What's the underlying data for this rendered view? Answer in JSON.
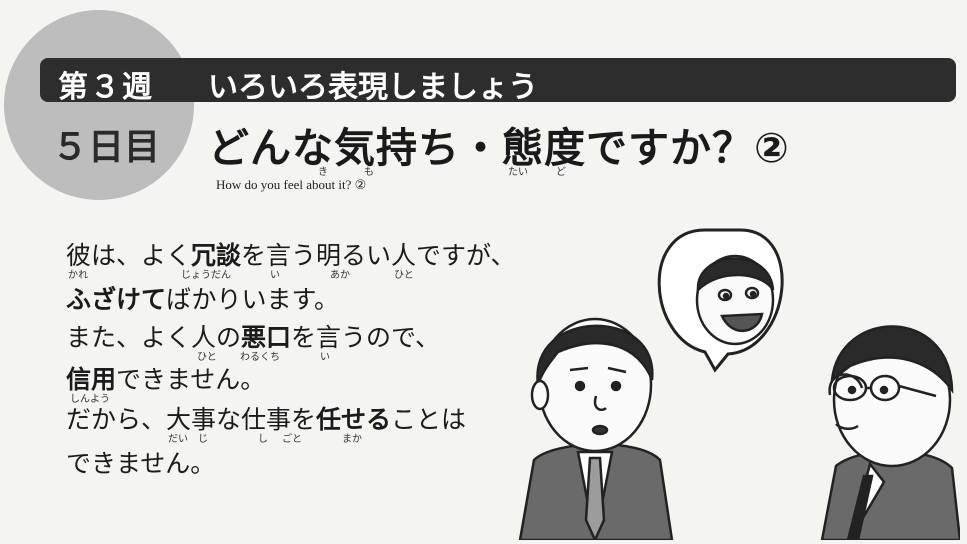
{
  "header": {
    "week_label": "第３週",
    "week_title": "いろいろ表現しましょう",
    "day_label": "５日目",
    "lesson_title": "どんな気持ち・態度ですか？②",
    "lesson_furigana": [
      "き",
      "も",
      "たい",
      "ど"
    ],
    "subtitle": "How do you feel about it? ②"
  },
  "passage": {
    "line1": {
      "a": "彼は、よく",
      "b": "冗談",
      "c": "を言う明るい人ですが、"
    },
    "line1_furigana": [
      "かれ",
      "じょうだん",
      "い",
      "あか",
      "ひと"
    ],
    "line2": {
      "a": "ふざけて",
      "b": "ばかりいます。"
    },
    "line3": {
      "a": "また、よく人の",
      "b": "悪口",
      "c": "を言うので、"
    },
    "line3_furigana": [
      "ひと",
      "わるくち",
      "い"
    ],
    "line4": {
      "a": "信用",
      "b": "できません。"
    },
    "line4_furigana": [
      "しんよう"
    ],
    "line5": {
      "a": "だから、大事な仕事を",
      "b": "任せる",
      "c": "ことは"
    },
    "line5_furigana": [
      "だい",
      "じ",
      "し",
      "ごと",
      "まか"
    ],
    "line6": "できません。"
  },
  "colors": {
    "bar": "#2d2d2d",
    "circle": "#bdbdbd",
    "background": "#f4f4f2"
  }
}
